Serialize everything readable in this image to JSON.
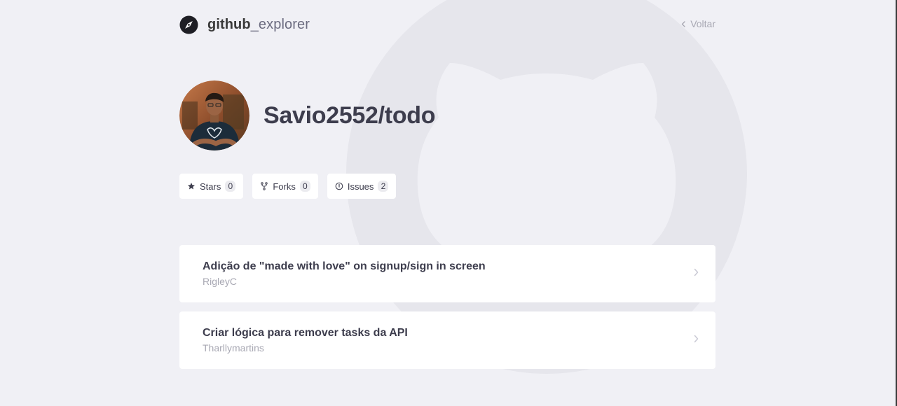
{
  "header": {
    "brand_strong": "github",
    "brand_rest": "_explorer",
    "brand_icon": "compass-icon",
    "back_label": "Voltar",
    "back_icon": "chevron-left-icon"
  },
  "repository": {
    "full_name": "Savio2552/todo",
    "avatar": "owner-avatar-photo"
  },
  "stats": [
    {
      "icon": "star-icon",
      "label": "Stars",
      "count": "0"
    },
    {
      "icon": "fork-icon",
      "label": "Forks",
      "count": "0"
    },
    {
      "icon": "alert-circle-icon",
      "label": "Issues",
      "count": "2"
    }
  ],
  "issues": [
    {
      "title": "Adição de \"made with love\" on signup/sign in screen",
      "author": "RigleyC"
    },
    {
      "title": "Criar lógica para remover tasks da API",
      "author": "Tharllymartins"
    }
  ],
  "colors": {
    "background": "#f0f0f5",
    "card": "#ffffff",
    "text_primary": "#3d3d4d",
    "text_muted": "#a8a8b3",
    "watermark": "#e6e6ec"
  }
}
